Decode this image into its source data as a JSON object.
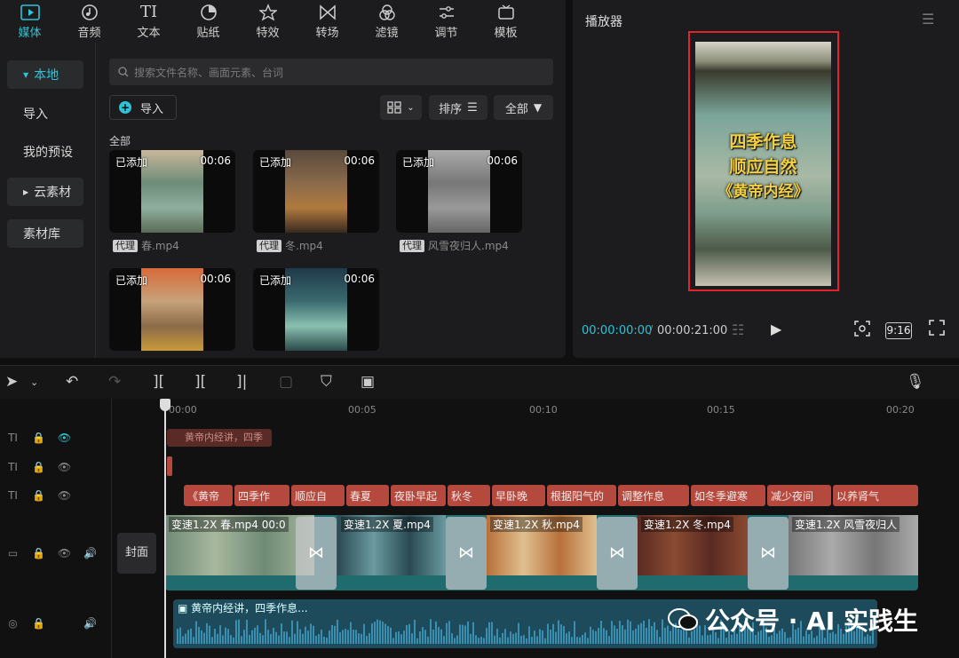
{
  "toolbar": {
    "tabs": [
      {
        "label": "媒体",
        "icon": "media-icon",
        "active": true
      },
      {
        "label": "音频",
        "icon": "audio-icon"
      },
      {
        "label": "文本",
        "icon": "text-icon"
      },
      {
        "label": "贴纸",
        "icon": "sticker-icon"
      },
      {
        "label": "特效",
        "icon": "effects-icon"
      },
      {
        "label": "转场",
        "icon": "transition-icon"
      },
      {
        "label": "滤镜",
        "icon": "filter-icon"
      },
      {
        "label": "调节",
        "icon": "adjust-icon"
      },
      {
        "label": "模板",
        "icon": "template-icon"
      }
    ]
  },
  "sidebar": {
    "items": [
      {
        "label": "本地",
        "selected": true
      },
      {
        "label": "导入"
      },
      {
        "label": "我的预设"
      },
      {
        "label": "云素材"
      },
      {
        "label": "素材库"
      }
    ]
  },
  "media": {
    "search_placeholder": "搜索文件名称、画面元素、台词",
    "import_label": "导入",
    "sort_label": "排序",
    "filter_label": "全部",
    "section_label": "全部",
    "added_label": "已添加",
    "proxy_label": "代理",
    "items": [
      {
        "name": "春.mp4",
        "duration": "00:06"
      },
      {
        "name": "冬.mp4",
        "duration": "00:06"
      },
      {
        "name": "风雪夜归人.mp4",
        "duration": "00:06"
      },
      {
        "name": "",
        "duration": "00:06"
      },
      {
        "name": "",
        "duration": "00:06"
      }
    ]
  },
  "player": {
    "title": "播放器",
    "video_text": [
      "四季作息",
      "顺应自然",
      "《黄帝内经》"
    ],
    "current_time": "00:00:00:00",
    "total_time": "00:00:21:00",
    "ratio": "9:16"
  },
  "timeline": {
    "ruler": [
      "00:00",
      "00:05",
      "00:10",
      "00:15",
      "00:20"
    ],
    "cover_label": "封面",
    "title_clip": "黄帝内经讲，四季",
    "text_clips": [
      "《黄帝",
      "四季作",
      "顺应自",
      "春夏",
      "夜卧早起",
      "秋冬",
      "早卧晚",
      "根据阳气的",
      "调整作息",
      "如冬季避寒",
      "减少夜间",
      "以养肾气"
    ],
    "video_clips": [
      {
        "speed": "变速1.2X",
        "name": "春.mp4",
        "extra": "00:0"
      },
      {
        "speed": "变速1.2X",
        "name": "夏.mp4",
        "extra": ""
      },
      {
        "speed": "变速1.2X",
        "name": "秋.mp4",
        "extra": ""
      },
      {
        "speed": "变速1.2X",
        "name": "冬.mp4",
        "extra": ""
      },
      {
        "speed": "变速1.2X",
        "name": "风雪夜归人",
        "extra": ""
      }
    ],
    "audio_label": "黄帝内经讲，四季作息..."
  },
  "watermark": {
    "text": "公众号 · AI 实践生"
  },
  "colors": {
    "accent": "#2ec4d6",
    "text_clip": "#b5493e",
    "video_track": "#1f6b6e",
    "highlight_box": "#e0242b"
  }
}
